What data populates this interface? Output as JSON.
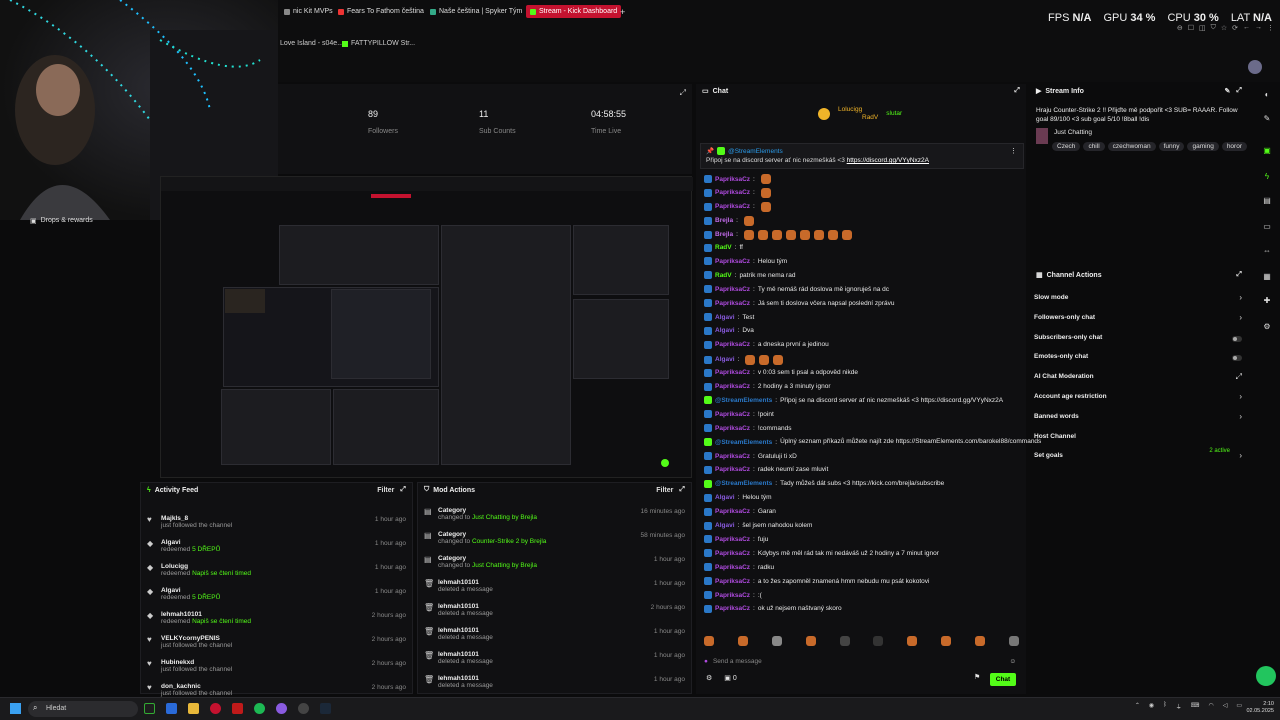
{
  "browser": {
    "tabs": [
      {
        "label": "nic Kit MVPs",
        "color": "#888"
      },
      {
        "label": "Fears To Fathom čeština",
        "color": "#e33"
      },
      {
        "label": "Naše čeština | Spyker Tým",
        "color": "#3a8"
      },
      {
        "label": "Stream - Kick Dashboard",
        "color": "#53fc18",
        "active": true
      },
      {
        "label": "+",
        "color": "#000"
      }
    ],
    "bookmarks": [
      {
        "label": "Love Island - s04e..."
      },
      {
        "label": "FATTYPILLOW Str..."
      }
    ],
    "stats": {
      "fps_label": "FPS",
      "fps": "N/A",
      "gpu_label": "GPU",
      "gpu": "34 %",
      "cpu_label": "CPU",
      "cpu": "30 %",
      "lat_label": "LAT",
      "lat": "N/A"
    }
  },
  "sidebar": {
    "drops_label": "Drops & rewards"
  },
  "channel_stats": [
    {
      "value": "89",
      "label": "Followers"
    },
    {
      "value": "11",
      "label": "Sub Counts"
    },
    {
      "value": "04:58:55",
      "label": "Time Live"
    }
  ],
  "activity_feed": {
    "title": "Activity Feed",
    "filter": "Filter",
    "items": [
      {
        "user": "Majkls_8",
        "desc": "just followed the channel",
        "highlight": "",
        "time": "1 hour ago",
        "icon": "heart-icon"
      },
      {
        "user": "Algavi",
        "desc": "redeemed",
        "highlight": "5 DŘEPŮ",
        "time": "1 hour ago",
        "icon": "gift-icon"
      },
      {
        "user": "Lolucigg",
        "desc": "redeemed",
        "highlight": "Napiš se čtení timed",
        "time": "1 hour ago",
        "icon": "gift-icon"
      },
      {
        "user": "Algavi",
        "desc": "redeemed",
        "highlight": "5 DŘEPŮ",
        "time": "1 hour ago",
        "icon": "gift-icon"
      },
      {
        "user": "lehmah10101",
        "desc": "redeemed",
        "highlight": "Napiš se čtení timed",
        "time": "2 hours ago",
        "icon": "gift-icon"
      },
      {
        "user": "VELKYcornyPENIS",
        "desc": "just followed the channel",
        "highlight": "",
        "time": "2 hours ago",
        "icon": "heart-icon"
      },
      {
        "user": "Hubinekxd",
        "desc": "just followed the channel",
        "highlight": "",
        "time": "2 hours ago",
        "icon": "heart-icon"
      },
      {
        "user": "don_kachnic",
        "desc": "just followed the channel",
        "highlight": "",
        "time": "2 hours ago",
        "icon": "heart-icon"
      }
    ]
  },
  "mod_actions": {
    "title": "Mod Actions",
    "filter": "Filter",
    "items": [
      {
        "user": "Category",
        "desc": "changed to",
        "highlight": "Just Chatting",
        "by": "by Brejla",
        "time": "16 minutes ago",
        "icon": "category-icon"
      },
      {
        "user": "Category",
        "desc": "changed to",
        "highlight": "Counter-Strike 2",
        "by": "by Brejla",
        "time": "58 minutes ago",
        "icon": "category-icon"
      },
      {
        "user": "Category",
        "desc": "changed to",
        "highlight": "Just Chatting",
        "by": "by Brejla",
        "time": "1 hour ago",
        "icon": "category-icon"
      },
      {
        "user": "lehmah10101",
        "desc": "deleted a message",
        "highlight": "",
        "by": "",
        "time": "1 hour ago",
        "icon": "trash-icon"
      },
      {
        "user": "lehmah10101",
        "desc": "deleted a message",
        "highlight": "",
        "by": "",
        "time": "2 hours ago",
        "icon": "trash-icon"
      },
      {
        "user": "lehmah10101",
        "desc": "deleted a message",
        "highlight": "",
        "by": "",
        "time": "1 hour ago",
        "icon": "trash-icon"
      },
      {
        "user": "lehmah10101",
        "desc": "deleted a message",
        "highlight": "",
        "by": "",
        "time": "1 hour ago",
        "icon": "trash-icon"
      },
      {
        "user": "lehmah10101",
        "desc": "deleted a message",
        "highlight": "",
        "by": "",
        "time": "1 hour ago",
        "icon": "trash-icon"
      }
    ]
  },
  "chat": {
    "title": "Chat",
    "top_users": [
      {
        "name": "Lolucigg"
      },
      {
        "name": "slutar"
      },
      {
        "name": "RadV"
      }
    ],
    "pinned_user": "@StreamElements",
    "pinned_text": "Připoj se na discord server ať nic nezmeškáš <3",
    "pinned_link": "https://discord.gg/VYyNxz2A",
    "messages": [
      {
        "user": "PapriksaCz",
        "text": "",
        "color": "#b04be0"
      },
      {
        "user": "PapriksaCz",
        "text": "",
        "color": "#b04be0"
      },
      {
        "user": "PapriksaCz",
        "text": "",
        "color": "#b04be0"
      },
      {
        "user": "Brejla",
        "text": "",
        "color": "#c06ae8"
      },
      {
        "user": "Brejla",
        "text": "",
        "color": "#c06ae8"
      },
      {
        "user": "RadV",
        "text": "ff",
        "color": "#53fc18"
      },
      {
        "user": "PapriksaCz",
        "text": "Helou tým",
        "color": "#b04be0"
      },
      {
        "user": "RadV",
        "text": "patrik me nema rad",
        "color": "#53fc18"
      },
      {
        "user": "PapriksaCz",
        "text": "Ty mě nemáš rád doslova mě ignoruješ na dc",
        "color": "#b04be0"
      },
      {
        "user": "PapriksaCz",
        "text": "Já sem ti doslova včera napsal poslední zprávu",
        "color": "#b04be0"
      },
      {
        "user": "Algavi",
        "text": "Test",
        "color": "#8a5be0"
      },
      {
        "user": "Algavi",
        "text": "Dva",
        "color": "#8a5be0"
      },
      {
        "user": "PapriksaCz",
        "text": "a dneska první a jedinou",
        "color": "#b04be0"
      },
      {
        "user": "Algavi",
        "text": "",
        "color": "#8a5be0"
      },
      {
        "user": "PapriksaCz",
        "text": "v 0:03 sem ti psal a odpověd nikde",
        "color": "#b04be0"
      },
      {
        "user": "PapriksaCz",
        "text": "2 hodiny a 3 minuty ignor",
        "color": "#b04be0"
      },
      {
        "user": "@StreamElements",
        "text": "Připoj se na discord server ať nic nezmeškáš <3 https://discord.gg/VYyNxz2A",
        "color": "#2a78c8"
      },
      {
        "user": "PapriksaCz",
        "text": "!point",
        "color": "#b04be0"
      },
      {
        "user": "PapriksaCz",
        "text": "!commands",
        "color": "#b04be0"
      },
      {
        "user": "@StreamElements",
        "text": "Úplný seznam příkazů můžete najít zde https://StreamElements.com/barokel88/commands",
        "color": "#2a78c8"
      },
      {
        "user": "PapriksaCz",
        "text": "Gratuluji ti xD",
        "color": "#b04be0"
      },
      {
        "user": "PapriksaCz",
        "text": "radek neumí zase mluvit",
        "color": "#b04be0"
      },
      {
        "user": "@StreamElements",
        "text": "Tady můžeš dát subs <3 https://kick.com/brejla/subscribe",
        "color": "#2a78c8"
      },
      {
        "user": "Algavi",
        "text": "Helou tým",
        "color": "#8a5be0"
      },
      {
        "user": "PapriksaCz",
        "text": "Garan",
        "color": "#b04be0"
      },
      {
        "user": "Algavi",
        "text": "šel jsem nahodou kolem",
        "color": "#8a5be0"
      },
      {
        "user": "PapriksaCz",
        "text": "fuju",
        "color": "#b04be0"
      },
      {
        "user": "PapriksaCz",
        "text": "Kdybys mě měl rád tak mi nedáváš už 2 hodiny a 7 minut ignor",
        "color": "#b04be0"
      },
      {
        "user": "PapriksaCz",
        "text": "radku",
        "color": "#b04be0"
      },
      {
        "user": "PapriksaCz",
        "text": "a to žes zapomněl znamená hmm nebudu mu psát kokotovi",
        "color": "#b04be0"
      },
      {
        "user": "PapriksaCz",
        "text": ":(",
        "color": "#b04be0"
      },
      {
        "user": "PapriksaCz",
        "text": "ok už nejsem naštvaný skoro",
        "color": "#b04be0"
      }
    ],
    "input_placeholder": "Send a message",
    "viewers": "0",
    "send_label": "Chat"
  },
  "stream_info": {
    "title": "Stream Info",
    "stream_title": "Hraju Counter-Strike 2 !! Přijďte mě podpořit <3 SUB= RAAAR. Follow goal 89/100 <3 sub goal 5/10 !8ball !dis",
    "category": "Just Chatting",
    "tags": [
      "Czech",
      "chill",
      "czechwoman",
      "funny",
      "gaming",
      "horor"
    ]
  },
  "channel_actions": {
    "title": "Channel Actions",
    "items": [
      {
        "label": "Slow mode",
        "control": "chevron"
      },
      {
        "label": "Followers-only chat",
        "control": "chevron"
      },
      {
        "label": "Subscribers-only chat",
        "control": "toggle"
      },
      {
        "label": "Emotes-only chat",
        "control": "toggle"
      },
      {
        "label": "AI Chat Moderation",
        "control": "external"
      },
      {
        "label": "Account age restriction",
        "control": "chevron"
      },
      {
        "label": "Banned words",
        "control": "chevron"
      },
      {
        "label": "Host Channel",
        "control": "none"
      },
      {
        "label": "Set goals",
        "control": "chevron"
      }
    ],
    "goals_status": "2 active"
  },
  "taskbar": {
    "search_placeholder": "Hledat",
    "clock_time": "2:10",
    "clock_date": "02.05.2025"
  }
}
